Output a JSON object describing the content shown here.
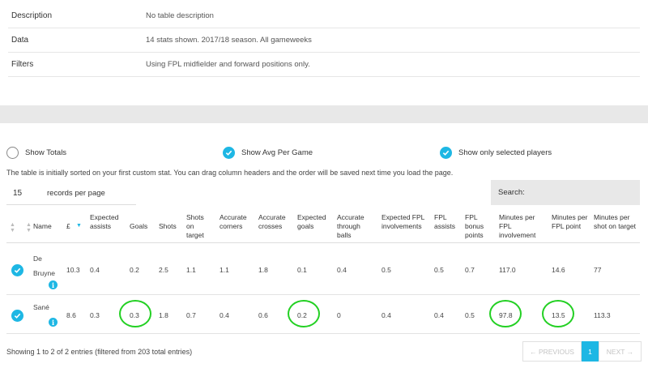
{
  "info": {
    "rows": [
      {
        "label": "Description",
        "value": "No table description"
      },
      {
        "label": "Data",
        "value": "14 stats shown. 2017/18 season. All gameweeks"
      },
      {
        "label": "Filters",
        "value": "Using FPL midfielder and forward positions only."
      }
    ]
  },
  "options": {
    "show_totals": "Show Totals",
    "show_avg": "Show Avg Per Game",
    "show_selected": "Show only selected players"
  },
  "hint": "The table is initially sorted on your first custom stat. You can drag column headers and the order will be saved next time you load the page.",
  "records": {
    "value": "15",
    "label": "records per page"
  },
  "search": {
    "label": "Search:"
  },
  "columns": [
    "Name",
    "£",
    "Expected assists",
    "Goals",
    "Shots",
    "Shots on target",
    "Accurate corners",
    "Accurate crosses",
    "Expected goals",
    "Accurate through balls",
    "Expected FPL involvements",
    "FPL assists",
    "FPL bonus points",
    "Minutes per FPL involvement",
    "Minutes per FPL point",
    "Minutes per shot on target"
  ],
  "players": [
    {
      "name": "De Bruyne",
      "price": "10.3",
      "xa": "0.4",
      "goals": "0.2",
      "shots": "2.5",
      "sot": "1.1",
      "corners": "1.1",
      "crosses": "1.8",
      "xg": "0.1",
      "through": "0.4",
      "xfpl": "0.5",
      "fpla": "0.5",
      "bonus": "0.7",
      "mpi": "117.0",
      "mpp": "14.6",
      "mpsot": "77"
    },
    {
      "name": "Sané",
      "price": "8.6",
      "xa": "0.3",
      "goals": "0.3",
      "shots": "1.8",
      "sot": "0.7",
      "corners": "0.4",
      "crosses": "0.6",
      "xg": "0.2",
      "through": "0",
      "xfpl": "0.4",
      "fpla": "0.4",
      "bonus": "0.5",
      "mpi": "97.8",
      "mpp": "13.5",
      "mpsot": "113.3"
    }
  ],
  "footer": {
    "text": "Showing 1 to 2 of 2 entries (filtered from 203 total entries)"
  },
  "pager": {
    "prev": "← PREVIOUS",
    "current": "1",
    "next": "NEXT →"
  },
  "colors": {
    "accent": "#1eb7e4",
    "highlight": "#23d023"
  }
}
